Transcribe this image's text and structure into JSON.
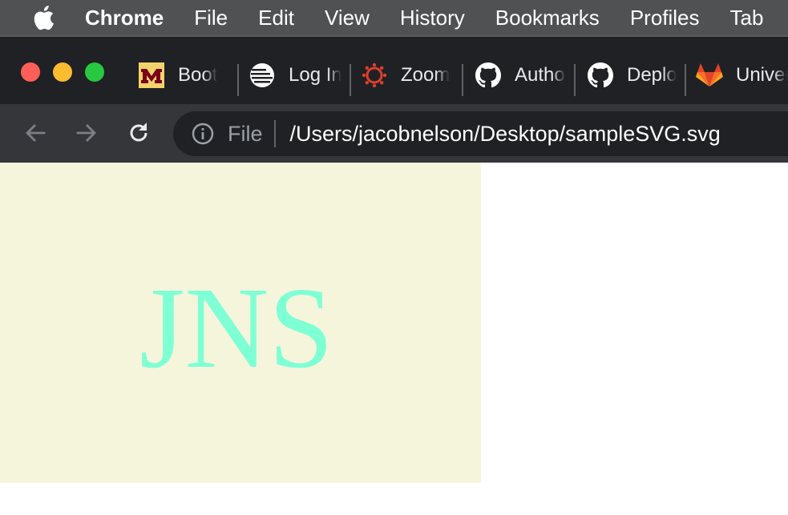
{
  "menubar": {
    "app_name": "Chrome",
    "items": [
      "File",
      "Edit",
      "View",
      "History",
      "Bookmarks",
      "Profiles",
      "Tab"
    ]
  },
  "tabs": [
    {
      "label": "Boot",
      "icon": "umn-m-icon"
    },
    {
      "label": "Log In",
      "icon": "lines-logo-icon"
    },
    {
      "label": "Zoom",
      "icon": "canvas-icon"
    },
    {
      "label": "Authorize",
      "icon": "github-icon"
    },
    {
      "label": "Deploy",
      "icon": "github-icon"
    },
    {
      "label": "University",
      "icon": "gitlab-icon"
    }
  ],
  "toolbar": {
    "scheme_label": "File",
    "url": "/Users/jacobnelson/Desktop/sampleSVG.svg"
  },
  "svg_page": {
    "text": "JNS",
    "background_color": "#f5f5dc",
    "text_color": "#7fffd4"
  },
  "colors": {
    "menubar_bg": "#505153",
    "tabstrip_bg": "#202124",
    "toolbar_bg": "#35363a"
  }
}
